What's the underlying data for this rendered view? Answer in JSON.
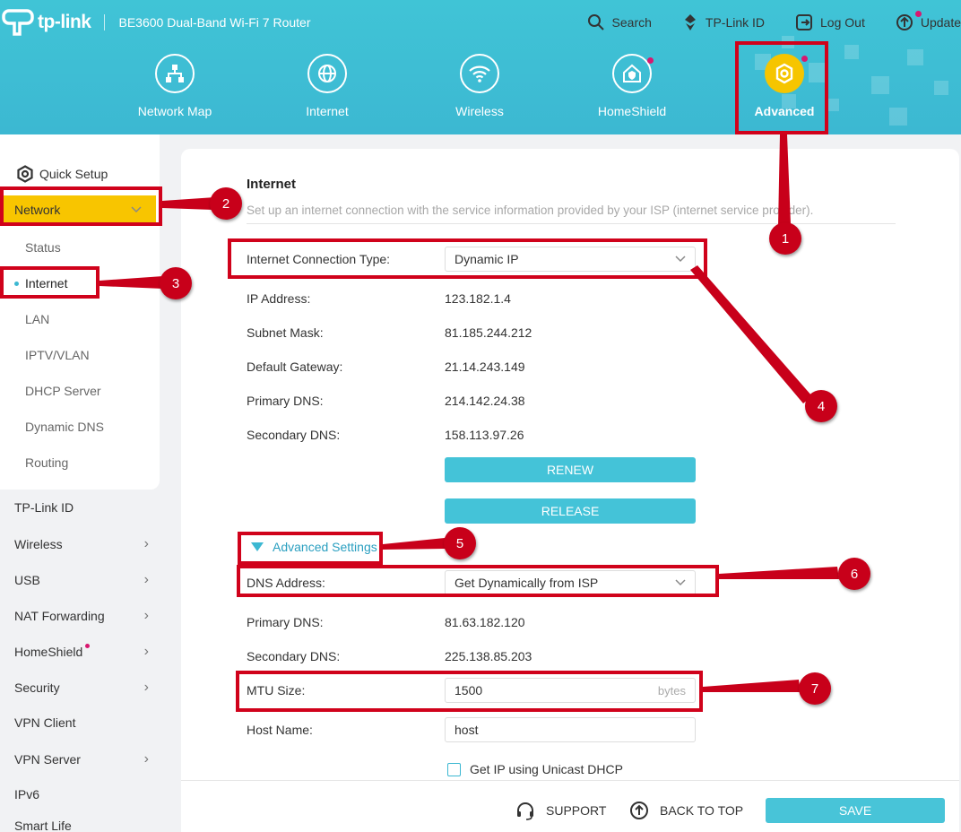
{
  "header": {
    "brand": "tp-link",
    "model": "BE3600 Dual-Band Wi-Fi 7 Router",
    "top_links": {
      "search": "Search",
      "tplink_id": "TP-Link ID",
      "logout": "Log Out",
      "update": "Update"
    },
    "tabs": [
      {
        "label": "Network Map",
        "icon": "network-map-icon"
      },
      {
        "label": "Internet",
        "icon": "globe-icon"
      },
      {
        "label": "Wireless",
        "icon": "wifi-icon"
      },
      {
        "label": "HomeShield",
        "icon": "homeshield-icon"
      },
      {
        "label": "Advanced",
        "icon": "advanced-gear-icon",
        "active": true
      }
    ]
  },
  "sidebar": {
    "quick_setup": "Quick Setup",
    "network": {
      "label": "Network",
      "sub": [
        "Status",
        "Internet",
        "LAN",
        "IPTV/VLAN",
        "DHCP Server",
        "Dynamic DNS",
        "Routing"
      ],
      "active_sub": "Internet"
    },
    "items": [
      {
        "label": "TP-Link ID",
        "chevron": false
      },
      {
        "label": "Wireless",
        "chevron": true
      },
      {
        "label": "USB",
        "chevron": true
      },
      {
        "label": "NAT Forwarding",
        "chevron": true
      },
      {
        "label": "HomeShield",
        "chevron": true
      },
      {
        "label": "Security",
        "chevron": true
      },
      {
        "label": "VPN Client",
        "chevron": false
      },
      {
        "label": "VPN Server",
        "chevron": true
      },
      {
        "label": "IPv6",
        "chevron": false
      },
      {
        "label": "Smart Life",
        "chevron": false
      }
    ]
  },
  "main": {
    "title": "Internet",
    "description": "Set up an internet connection with the service information provided by your ISP (internet service provider).",
    "connection_type": {
      "label": "Internet Connection Type:",
      "value": "Dynamic IP"
    },
    "ip_address": {
      "label": "IP Address:",
      "value": "123.182.1.4"
    },
    "subnet_mask": {
      "label": "Subnet Mask:",
      "value": "81.185.244.212"
    },
    "default_gateway": {
      "label": "Default Gateway:",
      "value": "21.14.243.149"
    },
    "primary_dns": {
      "label": "Primary DNS:",
      "value": "214.142.24.38"
    },
    "secondary_dns": {
      "label": "Secondary DNS:",
      "value": "158.113.97.26"
    },
    "renew": "RENEW",
    "release": "RELEASE",
    "advanced_settings": "Advanced Settings",
    "dns_address": {
      "label": "DNS Address:",
      "value": "Get Dynamically from ISP"
    },
    "adv_primary_dns": {
      "label": "Primary DNS:",
      "value": "81.63.182.120"
    },
    "adv_secondary_dns": {
      "label": "Secondary DNS:",
      "value": "225.138.85.203"
    },
    "mtu": {
      "label": "MTU Size:",
      "value": "1500",
      "unit": "bytes"
    },
    "host_name": {
      "label": "Host Name:",
      "value": "host"
    },
    "unicast_dhcp": "Get IP using Unicast DHCP"
  },
  "footer": {
    "support": "SUPPORT",
    "back_to_top": "BACK TO TOP",
    "save": "SAVE"
  },
  "annotations": [
    "1",
    "2",
    "3",
    "4",
    "5",
    "6",
    "7"
  ],
  "colors": {
    "header": "#3cb8d2",
    "accent_yellow": "#f8c500",
    "button": "#44c3d8",
    "annotation_red": "#d0021b",
    "notification_dot": "#d8186f"
  }
}
